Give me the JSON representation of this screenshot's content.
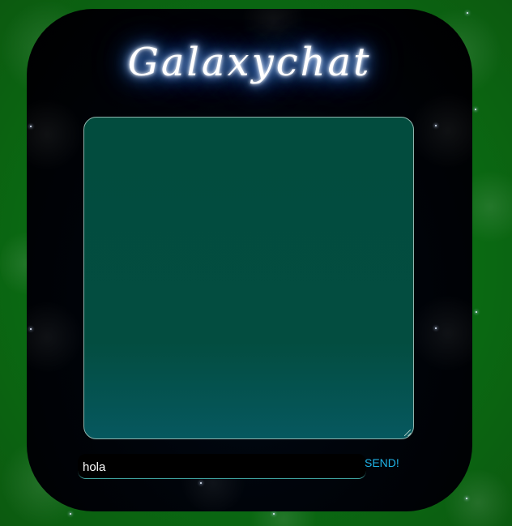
{
  "app": {
    "title": "Galaxychat"
  },
  "chat": {
    "messages": []
  },
  "composer": {
    "input_value": "hola",
    "send_label": "SEND!"
  },
  "colors": {
    "background": "#0a6a12",
    "panel": "#000000",
    "chat_area": "#024c3e",
    "send_accent": "#1fb3e6",
    "title_glow": "#2f7cff"
  }
}
